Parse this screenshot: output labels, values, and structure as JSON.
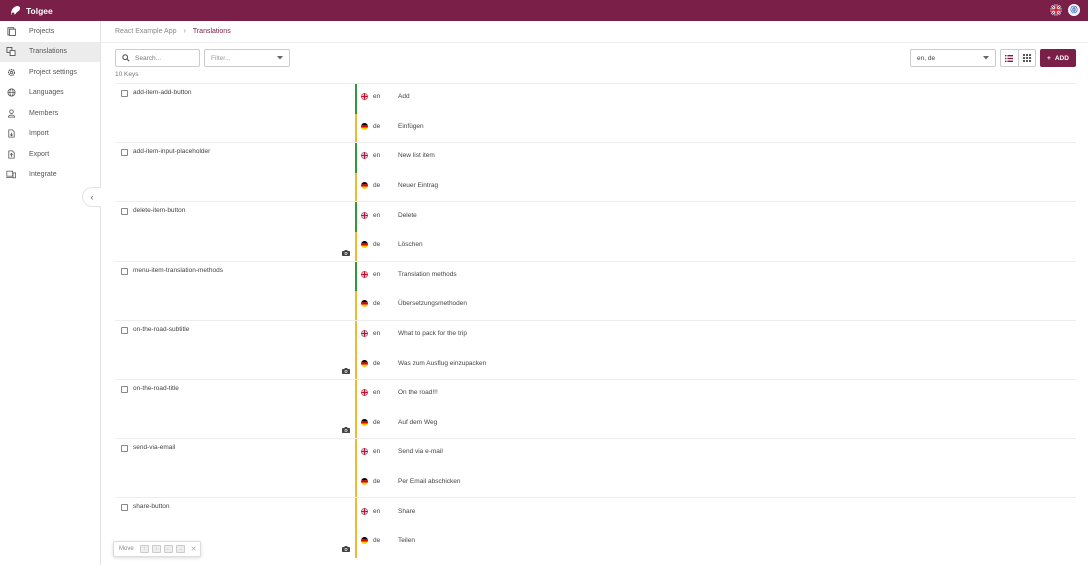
{
  "app": {
    "title": "Tolgee",
    "user_initial": "⓪"
  },
  "sidebar": {
    "items": [
      {
        "label": "Projects",
        "icon": "projects-icon"
      },
      {
        "label": "Translations",
        "icon": "translations-icon",
        "active": true
      },
      {
        "label": "Project settings",
        "icon": "settings-icon"
      },
      {
        "label": "Languages",
        "icon": "globe-icon"
      },
      {
        "label": "Members",
        "icon": "person-icon"
      },
      {
        "label": "Import",
        "icon": "import-icon"
      },
      {
        "label": "Export",
        "icon": "export-icon"
      },
      {
        "label": "Integrate",
        "icon": "integrate-icon"
      }
    ],
    "collapse_glyph": "‹"
  },
  "breadcrumb": {
    "project": "React Example App",
    "separator": "›",
    "current": "Translations"
  },
  "toolbar": {
    "search_placeholder": "Search...",
    "filter_placeholder": "Filter...",
    "languages_value": "en, de",
    "add_label": "ADD",
    "add_glyph": "+"
  },
  "key_count": "10 Keys",
  "colors": {
    "brand": "#7a2048",
    "en_bar": "#2e9a3c",
    "de_bar": "#f2b92e"
  },
  "rows": [
    {
      "key": "add-item-add-button",
      "screenshot": false,
      "en_bar": true,
      "translations": [
        {
          "lang": "en",
          "text": "Add"
        },
        {
          "lang": "de",
          "text": "Einfügen"
        }
      ]
    },
    {
      "key": "add-item-input-placeholder",
      "screenshot": false,
      "en_bar": true,
      "translations": [
        {
          "lang": "en",
          "text": "New list item"
        },
        {
          "lang": "de",
          "text": "Neuer Eintrag"
        }
      ]
    },
    {
      "key": "delete-item-button",
      "screenshot": true,
      "en_bar": true,
      "translations": [
        {
          "lang": "en",
          "text": "Delete"
        },
        {
          "lang": "de",
          "text": "Löschen"
        }
      ]
    },
    {
      "key": "menu-item-translation-methods",
      "screenshot": false,
      "en_bar": true,
      "translations": [
        {
          "lang": "en",
          "text": "Translation methods"
        },
        {
          "lang": "de",
          "text": "Übersetzungsmethoden"
        }
      ]
    },
    {
      "key": "on-the-road-subtitle",
      "screenshot": true,
      "en_bar": false,
      "translations": [
        {
          "lang": "en",
          "text": "What to pack for the trip"
        },
        {
          "lang": "de",
          "text": "Was zum Ausflug einzupacken"
        }
      ]
    },
    {
      "key": "on-the-road-title",
      "screenshot": true,
      "en_bar": false,
      "translations": [
        {
          "lang": "en",
          "text": "On the road!!!"
        },
        {
          "lang": "de",
          "text": "Auf dem Weg"
        }
      ]
    },
    {
      "key": "send-via-email",
      "screenshot": false,
      "en_bar": false,
      "translations": [
        {
          "lang": "en",
          "text": "Send via e-mail"
        },
        {
          "lang": "de",
          "text": "Per Email abschicken"
        }
      ]
    },
    {
      "key": "share-button",
      "screenshot": true,
      "en_bar": false,
      "translations": [
        {
          "lang": "en",
          "text": "Share"
        },
        {
          "lang": "de",
          "text": "Teilen"
        }
      ]
    }
  ],
  "move_hint": {
    "label": "Move",
    "keys": [
      "↑",
      "↓",
      "←",
      "→"
    ],
    "close": "✕"
  }
}
